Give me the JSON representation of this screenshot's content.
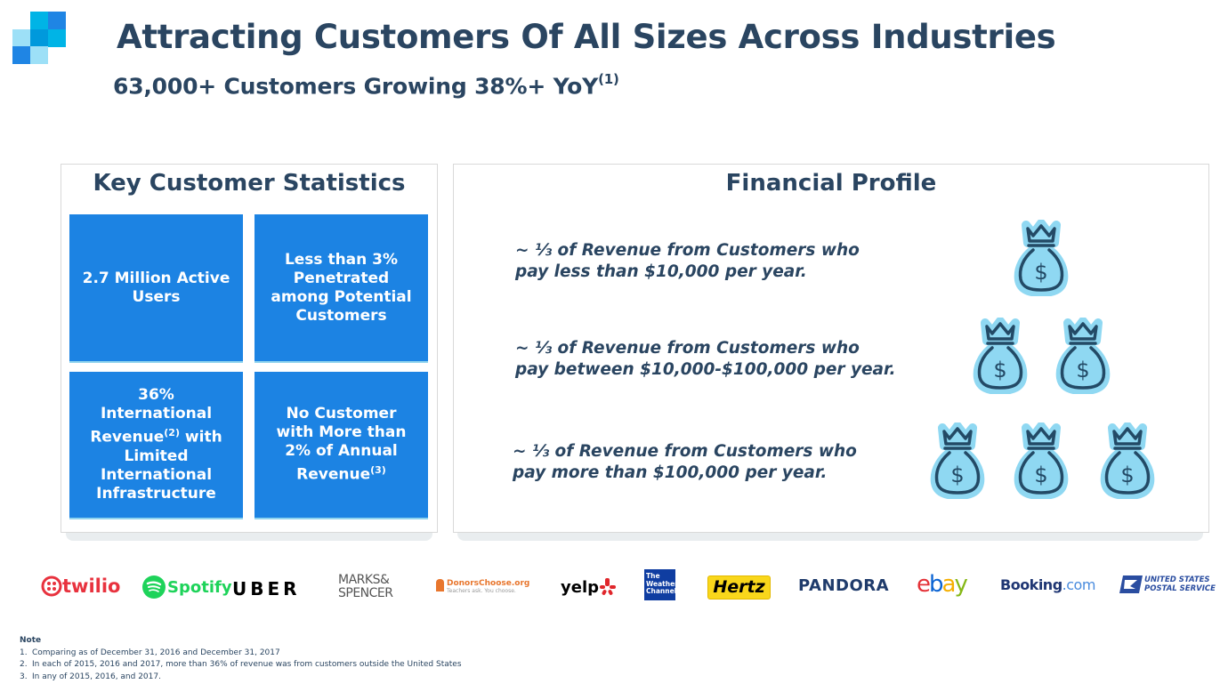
{
  "header": {
    "title": "Attracting Customers Of All Sizes Across Industries",
    "subtitle": "63,000+ Customers Growing 38%+ YoY",
    "subtitle_footnote": "(1)"
  },
  "logo_colors": [
    "#00b4e6",
    "#1f85e4",
    "#9de0f7",
    "#0099dc",
    "#00b4e6",
    "#1f85e4",
    "#9de0f7"
  ],
  "key_stats": {
    "title": "Key Customer Statistics",
    "cards": [
      {
        "text": "2.7 Million Active Users",
        "footnote": ""
      },
      {
        "text": "Less than 3% Penetrated among Potential Customers",
        "footnote": ""
      },
      {
        "text_before": "36% International Revenue",
        "footnote": "(2)",
        "text_after": " with Limited International Infrastructure"
      },
      {
        "text_before": "No Customer with More than 2% of Annual Revenue",
        "footnote": "(3)",
        "text_after": ""
      }
    ]
  },
  "financial_profile": {
    "title": "Financial Profile",
    "tiers": [
      {
        "line1": "~ ⅓ of Revenue from Customers who",
        "line2": "pay less than $10,000 per year.",
        "icon_count": 1,
        "icon": "money-bag-icon"
      },
      {
        "line1": "~ ⅓ of Revenue from Customers who",
        "line2": "pay between $10,000-$100,000 per year.",
        "icon_count": 2,
        "icon": "money-bag-icon"
      },
      {
        "line1": "~ ⅓ of Revenue from Customers who",
        "line2": "pay more than $100,000 per year.",
        "icon_count": 3,
        "icon": "money-bag-icon"
      }
    ],
    "icon_colors": {
      "fill": "#8fd8f2",
      "stroke": "#234a66"
    }
  },
  "customer_logos": [
    {
      "name": "twilio",
      "text": "twilio",
      "color": "#e8323e"
    },
    {
      "name": "spotify",
      "text": "Spotify",
      "color": "#1ed35a"
    },
    {
      "name": "uber",
      "text": "UBER",
      "color": "#000000"
    },
    {
      "name": "marks-spencer",
      "line1": "MARKS&",
      "line2": "SPENCER",
      "color": "#555555"
    },
    {
      "name": "donorschoose",
      "line1": "DonorsChoose.org",
      "line2": "Teachers ask. You choose.",
      "color": "#e8762d"
    },
    {
      "name": "yelp",
      "text": "yelp",
      "color": "#000000",
      "burst_color": "#e0262b"
    },
    {
      "name": "weather-channel",
      "line1": "The",
      "line2": "Weather",
      "line3": "Channel",
      "color": "#0f3da1"
    },
    {
      "name": "hertz",
      "text": "Hertz",
      "color": "#f9d71b"
    },
    {
      "name": "pandora",
      "text": "PANDORA",
      "color": "#1f3b6b"
    },
    {
      "name": "ebay",
      "letters": [
        "e",
        "b",
        "a",
        "y"
      ],
      "colors": [
        "#e43137",
        "#0b64d3",
        "#f5af02",
        "#86b817"
      ]
    },
    {
      "name": "booking",
      "text": "Booking",
      "suffix": ".com",
      "color": "#1f3673",
      "suffix_color": "#4a8cde"
    },
    {
      "name": "usps",
      "line1": "UNITED STATES",
      "line2": "POSTAL SERVICE",
      "color": "#2a4da0"
    }
  ],
  "notes": {
    "heading": "Note",
    "items": [
      {
        "num": "1.",
        "text": "Comparing as of December 31, 2016 and December 31, 2017"
      },
      {
        "num": "2.",
        "text": "In each of 2015, 2016 and 2017, more than 36% of revenue was from customers outside the United States"
      },
      {
        "num": "3.",
        "text": "In any of 2015, 2016, and 2017."
      }
    ]
  }
}
